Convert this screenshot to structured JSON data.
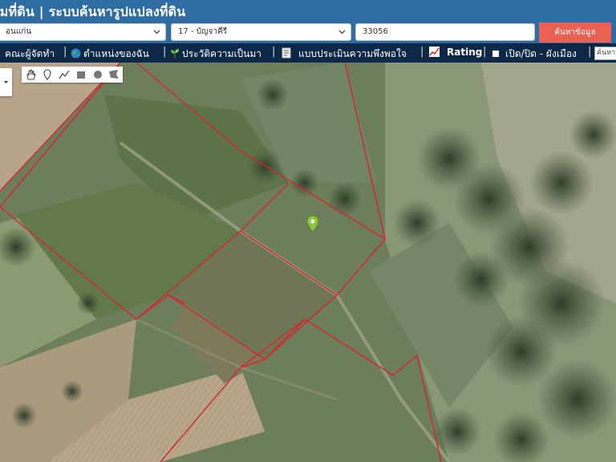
{
  "header": {
    "title": "รมที่ดิน | ระบบค้นหารูปแปลงที่ดิน"
  },
  "search": {
    "province": "อนแก่น",
    "district": "17 - บัญจาคีรี",
    "parcel_no": "33056",
    "button_label": "ค้นหาข้อมูล"
  },
  "menu": {
    "items": [
      {
        "label": "คณะผู้จัดทำ",
        "icon": null
      },
      {
        "label": "ตำแหน่งของฉัน",
        "icon": "globe-icon"
      },
      {
        "label": "ประวัติความเป็นมา",
        "icon": "sprout-icon"
      },
      {
        "label": "แบบประเมินความพึงพอใจ",
        "icon": "document-icon"
      },
      {
        "label": "Rating",
        "icon": "chart-icon"
      },
      {
        "label": "เปิด/ปิด - ผังเมือง",
        "icon": "checkbox-icon"
      }
    ],
    "map_search_placeholder": "ค้นหาส"
  },
  "map": {
    "parcel_line_color": "#d9232e",
    "marker_color": "#8cc63f",
    "draw_tools": [
      "hand-icon",
      "marker-icon",
      "polyline-icon",
      "rectangle-icon",
      "circle-icon",
      "polygon-icon"
    ]
  }
}
